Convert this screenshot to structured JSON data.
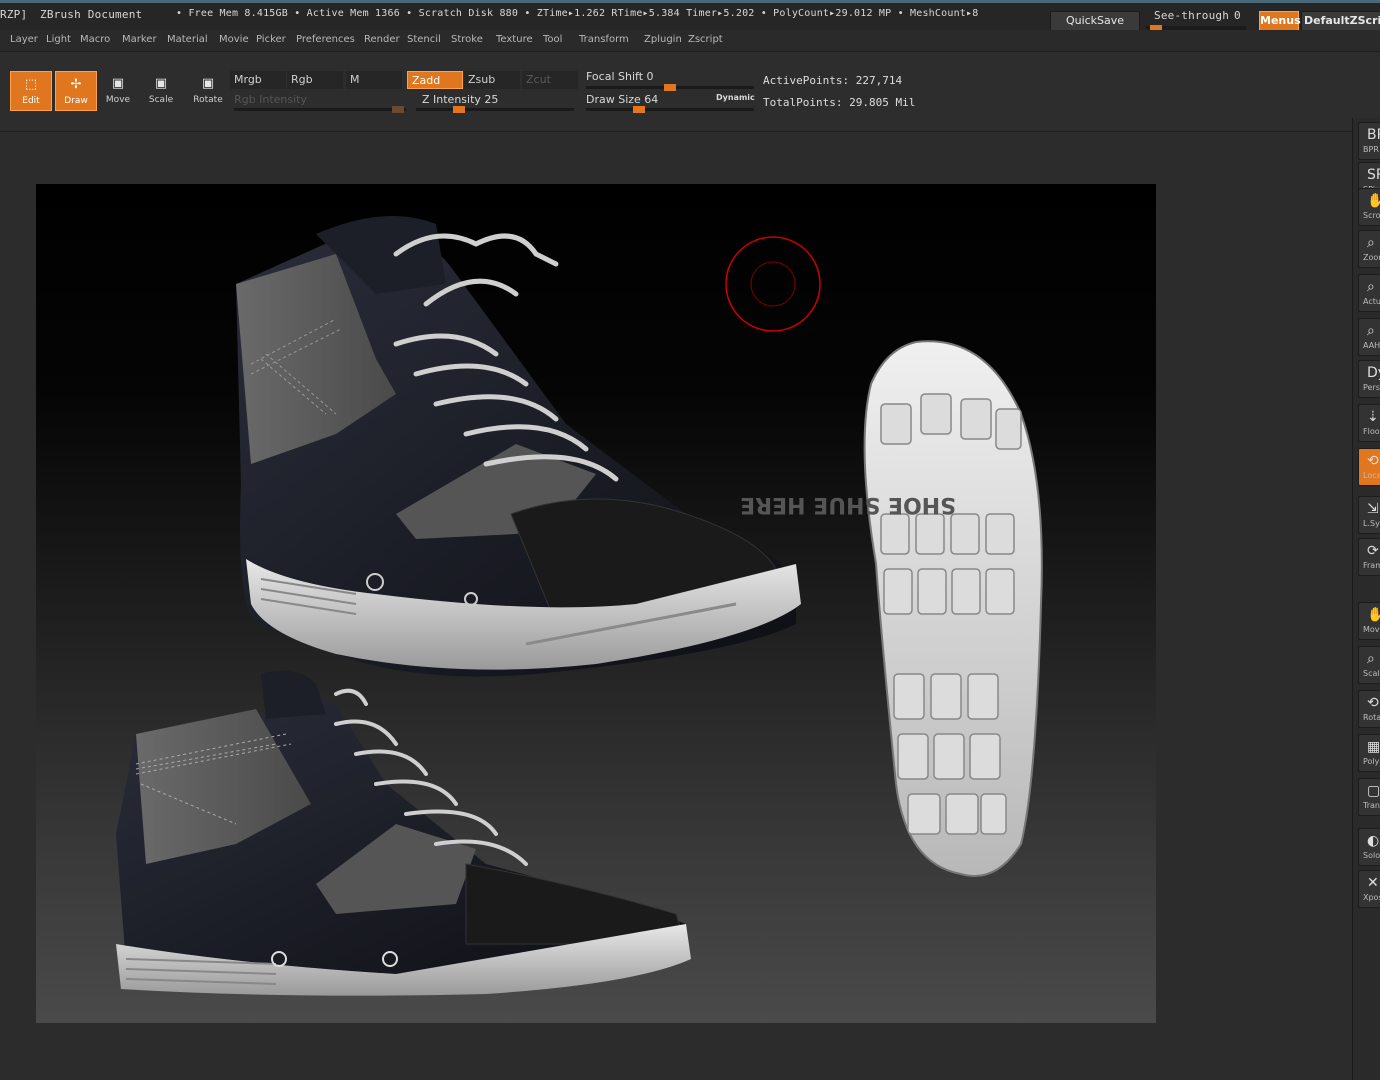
{
  "statusbar": {
    "doc_prefix": "RZP]",
    "doc_title": "ZBrush Document",
    "stats": "• Free Mem 8.415GB • Active Mem 1366 • Scratch Disk 880 • ZTime▸1.262 RTime▸5.384 Timer▸5.202 • PolyCount▸29.012 MP • MeshCount▸8",
    "quicksave_label": "QuickSave",
    "seethrough_label": "See-through",
    "seethrough_value": "0",
    "seethrough_fraction": 0.05,
    "menus_label": "Menus",
    "script_label": "DefaultZScript"
  },
  "menus": [
    "Layer",
    "Light",
    "Macro",
    "Marker",
    "Material",
    "Movie",
    "Picker",
    "Preferences",
    "Render",
    "Stencil",
    "Stroke",
    "Texture",
    "Tool",
    "Transform",
    "Zplugin",
    "Zscript"
  ],
  "toolbar": {
    "edit_label": "Edit",
    "draw_label": "Draw",
    "move_label": "Move",
    "scale_label": "Scale",
    "rotate_label": "Rotate",
    "mrgb": "Mrgb",
    "rgb": "Rgb",
    "m": "M",
    "zadd": "Zadd",
    "zsub": "Zsub",
    "zcut": "Zcut",
    "rgb_intensity": "Rgb Intensity",
    "z_intensity": "Z Intensity 25",
    "z_intensity_fraction": 0.25,
    "focal_shift": "Focal Shift 0",
    "focal_shift_fraction": 0.5,
    "draw_size": "Draw Size 64",
    "draw_size_fraction": 0.3,
    "dynamic": "Dynamic",
    "active_points": "ActivePoints: 227,714",
    "total_points": "TotalPoints: 29.805 Mil"
  },
  "viewport": {
    "sole_text": "SHOE SHUE HERE"
  },
  "shelf": [
    {
      "icon": "BP",
      "label": "BPR"
    },
    {
      "icon": "SPix",
      "label": "SPix"
    },
    {
      "icon": "✋",
      "label": "Scroll"
    },
    {
      "icon": "⌕",
      "label": "Zoom"
    },
    {
      "icon": "⌕",
      "label": "Actual"
    },
    {
      "icon": "⌕",
      "label": "AAHalf"
    },
    {
      "icon": "Dynamic",
      "label": "Persp"
    },
    {
      "icon": "⇣",
      "label": "Floor"
    },
    {
      "icon": "⟲",
      "label": "Local"
    },
    {
      "icon": "⇲",
      "label": "L.Sym"
    },
    {
      "icon": "⟳",
      "label": "Frame"
    },
    {
      "icon": "✋",
      "label": "Move"
    },
    {
      "icon": "⌕",
      "label": "Scale"
    },
    {
      "icon": "⟲",
      "label": "Rotate"
    },
    {
      "icon": "▦",
      "label": "PolyF"
    },
    {
      "icon": "▢",
      "label": "Transp"
    },
    {
      "icon": "◐",
      "label": "Solo"
    },
    {
      "icon": "✕",
      "label": "Xpose"
    }
  ]
}
